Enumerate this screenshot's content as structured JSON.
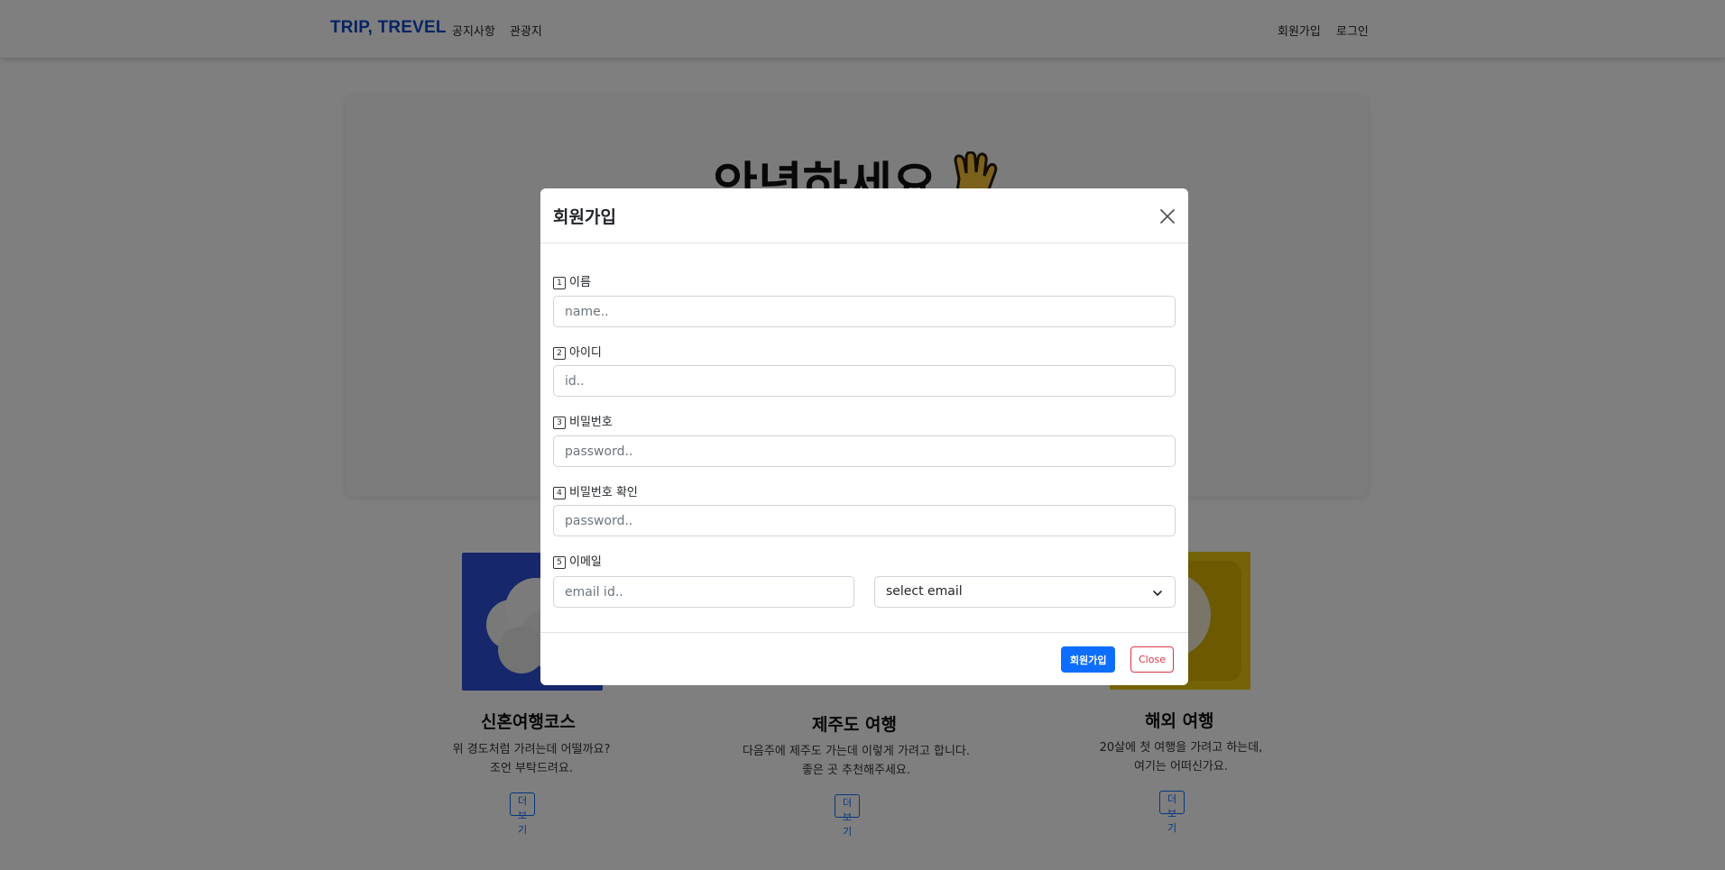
{
  "navbar": {
    "brand": "TRIP, TREVEL",
    "links": [
      "공지사항",
      "관광지"
    ],
    "right_links": [
      "회원가입",
      "로그인"
    ],
    "brand_color": "#0d47c9"
  },
  "hero": {
    "title": "안녕하세요"
  },
  "cards": [
    {
      "title": "신혼여행코스",
      "lines": [
        "위 경도처럼 가려는데 어떨까요?",
        "조언 부탁드려요."
      ],
      "button": "더보기",
      "image": "cloud-image"
    },
    {
      "title": "제주도 여행",
      "lines": [
        "다음주에 제주도 가는데 이렇게 가려고 합니다.",
        "좋은 곳 추천해주세요."
      ],
      "button": "더보기",
      "image": ""
    },
    {
      "title": "해외 여행",
      "lines": [
        "20살에 첫 여행을 가려고 하는데,",
        "여기는 어떠신가요."
      ],
      "button": "더보기",
      "image": "lightbulb-image"
    }
  ],
  "modal": {
    "title": "회원가입",
    "fields": [
      {
        "num": "1",
        "label": "이름",
        "placeholder": "name.."
      },
      {
        "num": "2",
        "label": "아이디",
        "placeholder": "id.."
      },
      {
        "num": "3",
        "label": "비밀번호",
        "placeholder": "password.."
      },
      {
        "num": "4",
        "label": "비밀번호 확인",
        "placeholder": "password.."
      },
      {
        "num": "5",
        "label": "이메일",
        "placeholder": "email id.."
      }
    ],
    "email_select": "select email",
    "submit_label": "회원가입",
    "close_label": "Close",
    "primary_color": "#0d6efd",
    "danger_color": "#dc3545"
  }
}
